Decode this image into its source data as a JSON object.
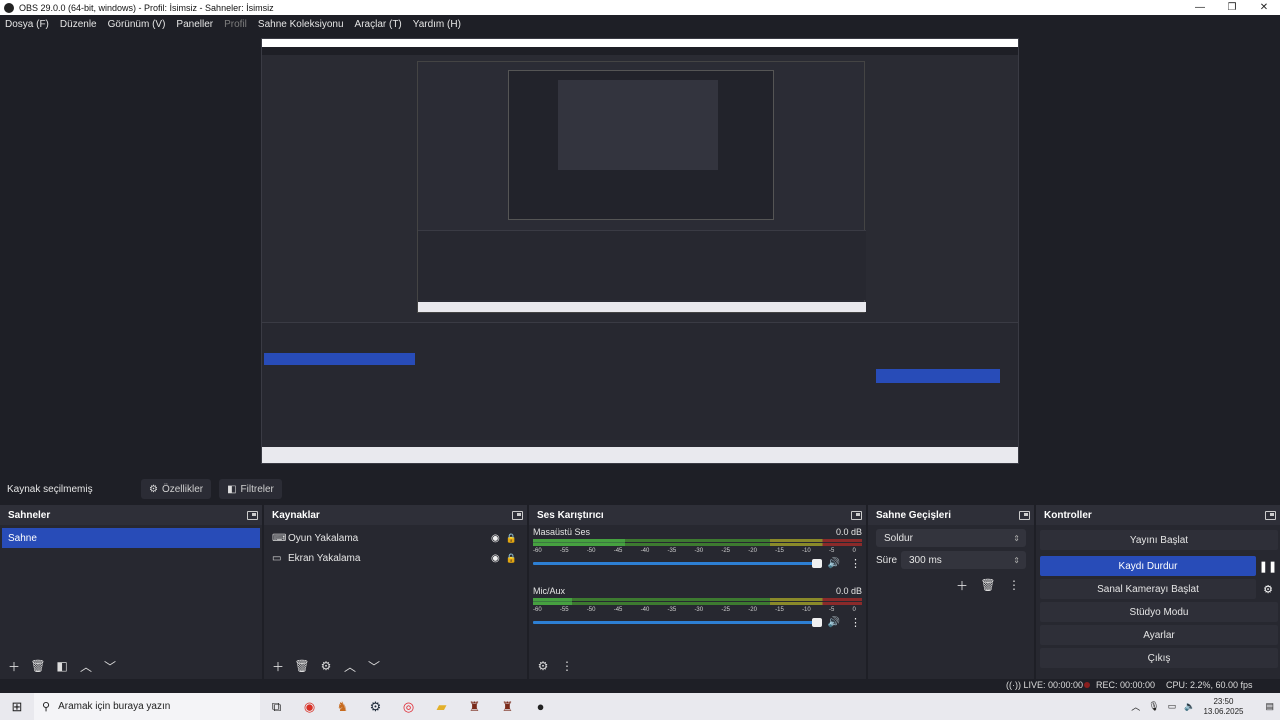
{
  "window": {
    "title": "OBS 29.0.0 (64-bit, windows) - Profil: İsimsiz - Sahneler: İsimsiz",
    "minimize": "—",
    "restore": "❐",
    "close": "✕"
  },
  "menu": [
    "Dosya (F)",
    "Düzenle",
    "Görünüm (V)",
    "Paneller",
    "Profil",
    "Sahne Koleksiyonu",
    "Araçlar (T)",
    "Yardım (H)"
  ],
  "props": {
    "no_source": "Kaynak seçilmemiş",
    "properties": "Özellikler",
    "filters": "Filtreler"
  },
  "scenes": {
    "title": "Sahneler",
    "items": [
      "Sahne"
    ]
  },
  "sources": {
    "title": "Kaynaklar",
    "items": [
      {
        "label": "Oyun Yakalama",
        "icon": "gamepad-icon"
      },
      {
        "label": "Ekran Yakalama",
        "icon": "monitor-icon"
      }
    ]
  },
  "mixer": {
    "title": "Ses Karıştırıcı",
    "channels": [
      {
        "name": "Masaüstü Ses",
        "db": "0.0 dB"
      },
      {
        "name": "Mic/Aux",
        "db": "0.0 dB"
      }
    ],
    "scale": [
      "-60",
      "-55",
      "-50",
      "-45",
      "-40",
      "-35",
      "-30",
      "-25",
      "-20",
      "-15",
      "-10",
      "-5",
      "0"
    ]
  },
  "transitions": {
    "title": "Sahne Geçişleri",
    "selected": "Soldur",
    "duration_label": "Süre",
    "duration": "300 ms"
  },
  "controls": {
    "title": "Kontroller",
    "start_stream": "Yayını Başlat",
    "stop_record": "Kaydı Durdur",
    "virtual_cam": "Sanal Kamerayı Başlat",
    "studio": "Stüdyo Modu",
    "settings": "Ayarlar",
    "exit": "Çıkış"
  },
  "status": {
    "live": "LIVE: 00:00:00",
    "rec": "REC: 00:00:00",
    "cpu": "CPU: 2.2%, 60.00 fps"
  },
  "taskbar": {
    "search": "Aramak için buraya yazın",
    "time": "23:50",
    "date": "13.06.2025"
  },
  "colors": {
    "accent": "#284cb8",
    "bg": "#1e1f26",
    "dock": "#272830"
  }
}
